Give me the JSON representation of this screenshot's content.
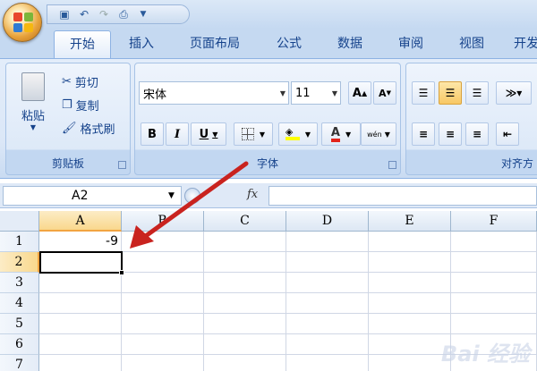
{
  "tabs": [
    "开始",
    "插入",
    "页面布局",
    "公式",
    "数据",
    "审阅",
    "视图",
    "开发"
  ],
  "ribbon": {
    "clipboard": {
      "paste": "粘贴",
      "cut": "剪切",
      "copy": "复制",
      "format_painter": "格式刷",
      "label": "剪贴板"
    },
    "font": {
      "name": "宋体",
      "size": "11",
      "grow": "A",
      "shrink": "A",
      "bold": "B",
      "italic": "I",
      "underline": "U",
      "font_color": "A",
      "phonetic": "wén",
      "label": "字体"
    },
    "alignment": {
      "label": "对齐方"
    }
  },
  "formula_bar": {
    "name_box": "A2",
    "fx": "fx",
    "value": ""
  },
  "sheet": {
    "columns": [
      "A",
      "B",
      "C",
      "D",
      "E",
      "F"
    ],
    "rows": [
      "1",
      "2",
      "3",
      "4",
      "5",
      "6",
      "7"
    ],
    "a1": "-9",
    "selected_cell": "A2"
  },
  "colors": {
    "arrow": "#c9231f",
    "selection": "#f9d88d"
  },
  "watermark": "Bai 经验"
}
